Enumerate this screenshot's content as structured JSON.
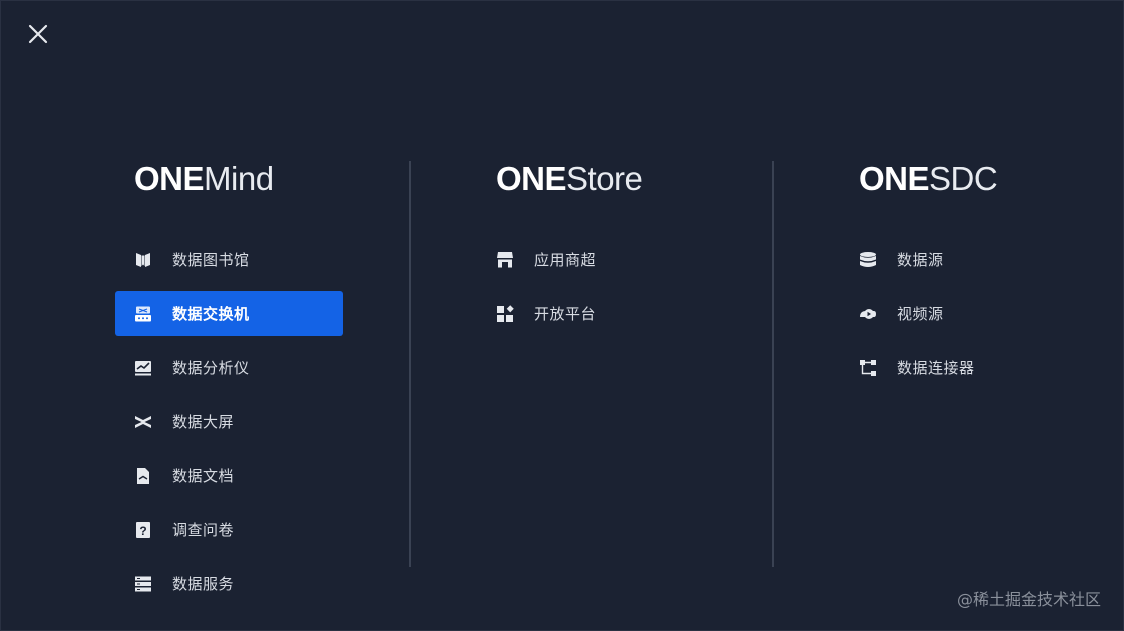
{
  "close_icon": "close-icon",
  "columns": [
    {
      "brand_strong": "ONE",
      "brand_light": "Mind",
      "items": [
        {
          "label": "数据图书馆",
          "icon": "book-icon"
        },
        {
          "label": "数据交换机",
          "icon": "exchange-icon",
          "active": true
        },
        {
          "label": "数据分析仪",
          "icon": "chart-icon"
        },
        {
          "label": "数据大屏",
          "icon": "screen-icon"
        },
        {
          "label": "数据文档",
          "icon": "document-icon"
        },
        {
          "label": "调查问卷",
          "icon": "question-icon"
        },
        {
          "label": "数据服务",
          "icon": "server-icon"
        }
      ]
    },
    {
      "brand_strong": "ONE",
      "brand_light": "Store",
      "items": [
        {
          "label": "应用商超",
          "icon": "store-icon"
        },
        {
          "label": "开放平台",
          "icon": "platform-icon"
        }
      ]
    },
    {
      "brand_strong": "ONE",
      "brand_light": "SDC",
      "items": [
        {
          "label": "数据源",
          "icon": "database-icon"
        },
        {
          "label": "视频源",
          "icon": "video-icon"
        },
        {
          "label": "数据连接器",
          "icon": "connector-icon"
        }
      ]
    }
  ],
  "watermark": "@稀土掘金技术社区",
  "colors": {
    "background": "#1b2232",
    "active": "#1463e6",
    "text": "#d7dbe2",
    "divider": "#3a4253"
  }
}
